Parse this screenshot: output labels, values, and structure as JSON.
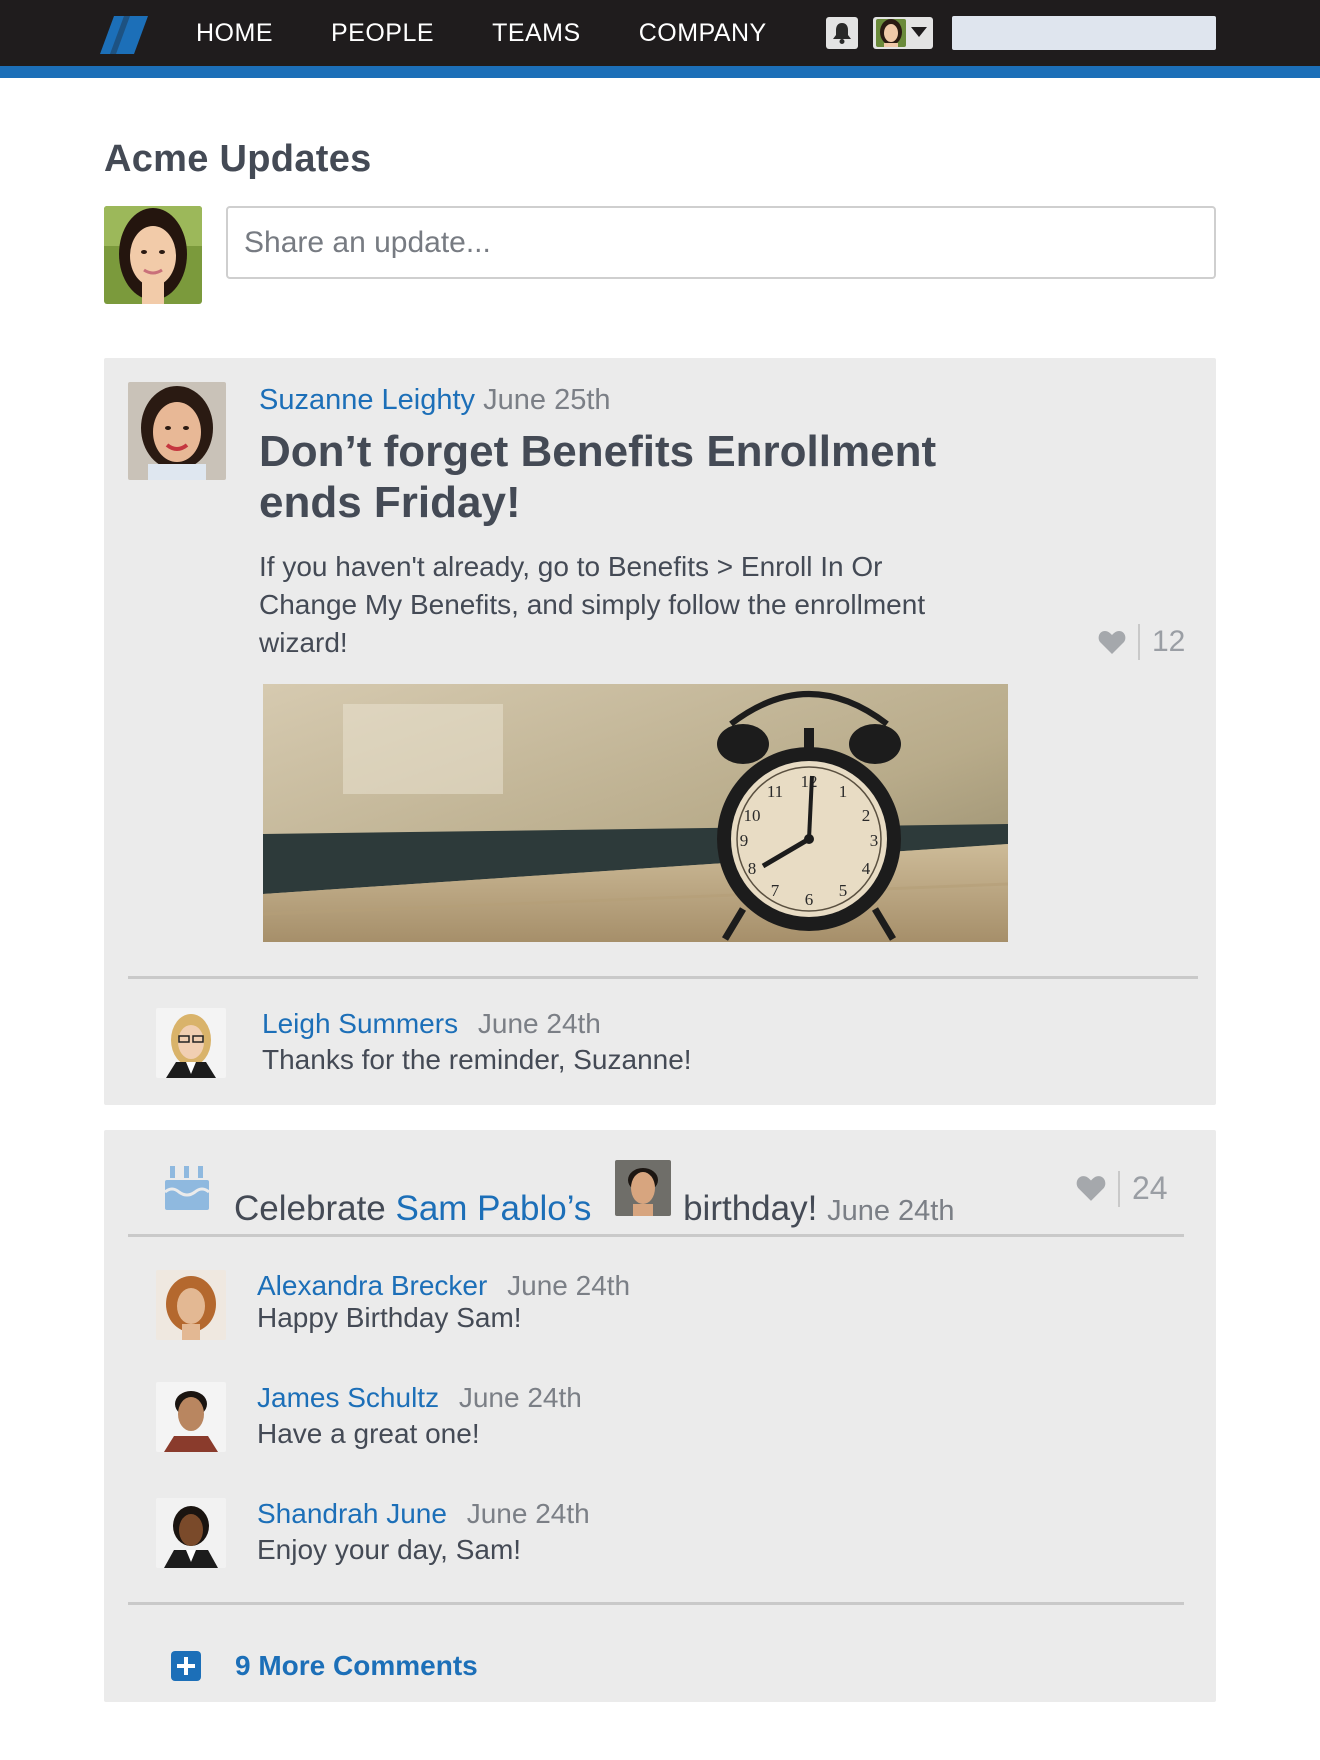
{
  "app": {
    "nav": [
      "HOME",
      "PEOPLE",
      "TEAMS",
      "COMPANY"
    ],
    "brand_color": "#1c6fb8",
    "topbar_color": "#1f1c1d"
  },
  "header": {
    "title": "Acme Updates",
    "share_placeholder": "Share an update..."
  },
  "post": {
    "author": "Suzanne Leighty",
    "date": "June 25th",
    "title": "Don’t forget Benefits Enrollment ends Friday!",
    "body": "If you haven't already, go to Benefits > Enroll In Or Change My Benefits, and simply follow the enrollment wizard!",
    "likes": "12",
    "comments": [
      {
        "author": "Leigh Summers",
        "date": "June 24th",
        "text": "Thanks for the reminder, Suzanne!"
      }
    ]
  },
  "birthday": {
    "prefix": "Celebrate ",
    "person": "Sam Pablo’s",
    "suffix": "birthday!",
    "date": "June 24th",
    "likes": "24",
    "comments": [
      {
        "author": "Alexandra Brecker",
        "date": "June 24th",
        "text": "Happy Birthday Sam!"
      },
      {
        "author": "James Schultz",
        "date": "June 24th",
        "text": "Have a great one!"
      },
      {
        "author": "Shandrah June",
        "date": "June 24th",
        "text": "Enjoy your day, Sam!"
      }
    ],
    "more_label": "9 More Comments"
  }
}
